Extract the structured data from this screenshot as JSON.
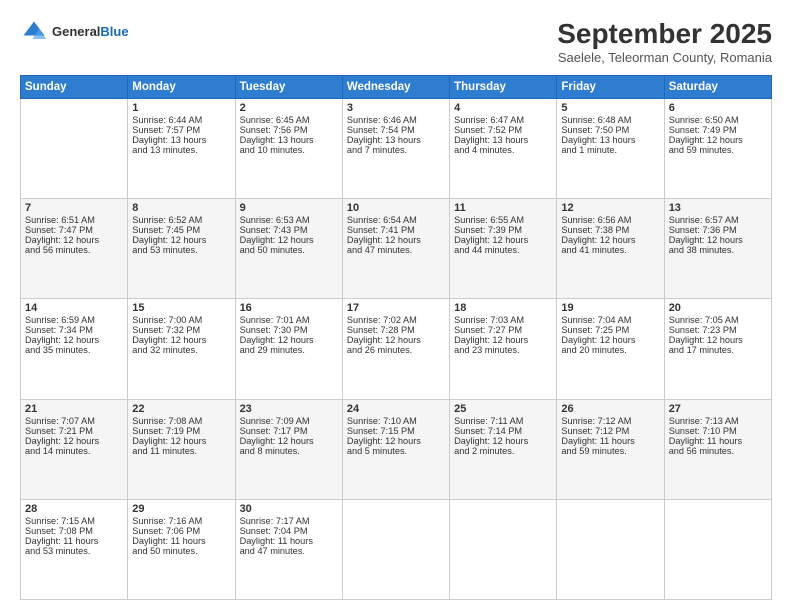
{
  "header": {
    "logo_line1": "General",
    "logo_line2": "Blue",
    "month": "September 2025",
    "location": "Saelele, Teleorman County, Romania"
  },
  "weekdays": [
    "Sunday",
    "Monday",
    "Tuesday",
    "Wednesday",
    "Thursday",
    "Friday",
    "Saturday"
  ],
  "rows": [
    [
      {
        "day": "",
        "text": ""
      },
      {
        "day": "1",
        "text": "Sunrise: 6:44 AM\nSunset: 7:57 PM\nDaylight: 13 hours\nand 13 minutes."
      },
      {
        "day": "2",
        "text": "Sunrise: 6:45 AM\nSunset: 7:56 PM\nDaylight: 13 hours\nand 10 minutes."
      },
      {
        "day": "3",
        "text": "Sunrise: 6:46 AM\nSunset: 7:54 PM\nDaylight: 13 hours\nand 7 minutes."
      },
      {
        "day": "4",
        "text": "Sunrise: 6:47 AM\nSunset: 7:52 PM\nDaylight: 13 hours\nand 4 minutes."
      },
      {
        "day": "5",
        "text": "Sunrise: 6:48 AM\nSunset: 7:50 PM\nDaylight: 13 hours\nand 1 minute."
      },
      {
        "day": "6",
        "text": "Sunrise: 6:50 AM\nSunset: 7:49 PM\nDaylight: 12 hours\nand 59 minutes."
      }
    ],
    [
      {
        "day": "7",
        "text": "Sunrise: 6:51 AM\nSunset: 7:47 PM\nDaylight: 12 hours\nand 56 minutes."
      },
      {
        "day": "8",
        "text": "Sunrise: 6:52 AM\nSunset: 7:45 PM\nDaylight: 12 hours\nand 53 minutes."
      },
      {
        "day": "9",
        "text": "Sunrise: 6:53 AM\nSunset: 7:43 PM\nDaylight: 12 hours\nand 50 minutes."
      },
      {
        "day": "10",
        "text": "Sunrise: 6:54 AM\nSunset: 7:41 PM\nDaylight: 12 hours\nand 47 minutes."
      },
      {
        "day": "11",
        "text": "Sunrise: 6:55 AM\nSunset: 7:39 PM\nDaylight: 12 hours\nand 44 minutes."
      },
      {
        "day": "12",
        "text": "Sunrise: 6:56 AM\nSunset: 7:38 PM\nDaylight: 12 hours\nand 41 minutes."
      },
      {
        "day": "13",
        "text": "Sunrise: 6:57 AM\nSunset: 7:36 PM\nDaylight: 12 hours\nand 38 minutes."
      }
    ],
    [
      {
        "day": "14",
        "text": "Sunrise: 6:59 AM\nSunset: 7:34 PM\nDaylight: 12 hours\nand 35 minutes."
      },
      {
        "day": "15",
        "text": "Sunrise: 7:00 AM\nSunset: 7:32 PM\nDaylight: 12 hours\nand 32 minutes."
      },
      {
        "day": "16",
        "text": "Sunrise: 7:01 AM\nSunset: 7:30 PM\nDaylight: 12 hours\nand 29 minutes."
      },
      {
        "day": "17",
        "text": "Sunrise: 7:02 AM\nSunset: 7:28 PM\nDaylight: 12 hours\nand 26 minutes."
      },
      {
        "day": "18",
        "text": "Sunrise: 7:03 AM\nSunset: 7:27 PM\nDaylight: 12 hours\nand 23 minutes."
      },
      {
        "day": "19",
        "text": "Sunrise: 7:04 AM\nSunset: 7:25 PM\nDaylight: 12 hours\nand 20 minutes."
      },
      {
        "day": "20",
        "text": "Sunrise: 7:05 AM\nSunset: 7:23 PM\nDaylight: 12 hours\nand 17 minutes."
      }
    ],
    [
      {
        "day": "21",
        "text": "Sunrise: 7:07 AM\nSunset: 7:21 PM\nDaylight: 12 hours\nand 14 minutes."
      },
      {
        "day": "22",
        "text": "Sunrise: 7:08 AM\nSunset: 7:19 PM\nDaylight: 12 hours\nand 11 minutes."
      },
      {
        "day": "23",
        "text": "Sunrise: 7:09 AM\nSunset: 7:17 PM\nDaylight: 12 hours\nand 8 minutes."
      },
      {
        "day": "24",
        "text": "Sunrise: 7:10 AM\nSunset: 7:15 PM\nDaylight: 12 hours\nand 5 minutes."
      },
      {
        "day": "25",
        "text": "Sunrise: 7:11 AM\nSunset: 7:14 PM\nDaylight: 12 hours\nand 2 minutes."
      },
      {
        "day": "26",
        "text": "Sunrise: 7:12 AM\nSunset: 7:12 PM\nDaylight: 11 hours\nand 59 minutes."
      },
      {
        "day": "27",
        "text": "Sunrise: 7:13 AM\nSunset: 7:10 PM\nDaylight: 11 hours\nand 56 minutes."
      }
    ],
    [
      {
        "day": "28",
        "text": "Sunrise: 7:15 AM\nSunset: 7:08 PM\nDaylight: 11 hours\nand 53 minutes."
      },
      {
        "day": "29",
        "text": "Sunrise: 7:16 AM\nSunset: 7:06 PM\nDaylight: 11 hours\nand 50 minutes."
      },
      {
        "day": "30",
        "text": "Sunrise: 7:17 AM\nSunset: 7:04 PM\nDaylight: 11 hours\nand 47 minutes."
      },
      {
        "day": "",
        "text": ""
      },
      {
        "day": "",
        "text": ""
      },
      {
        "day": "",
        "text": ""
      },
      {
        "day": "",
        "text": ""
      }
    ]
  ]
}
